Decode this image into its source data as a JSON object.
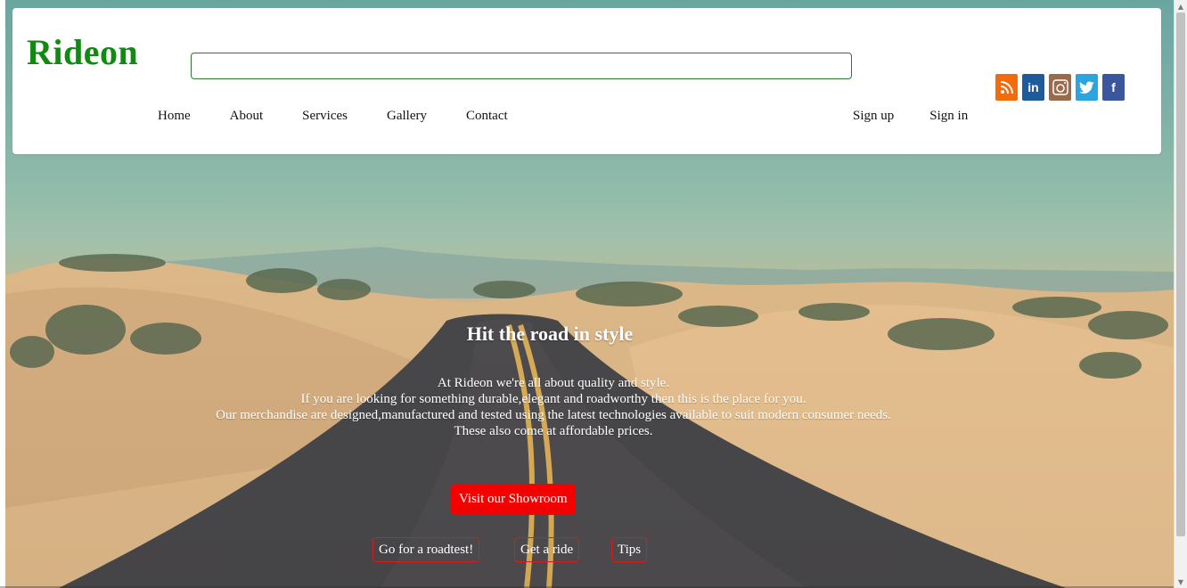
{
  "brand": {
    "name": "Rideon",
    "color": "#128a12"
  },
  "search": {
    "value": "",
    "placeholder": ""
  },
  "nav": {
    "items": [
      {
        "label": "Home"
      },
      {
        "label": "About"
      },
      {
        "label": "Services"
      },
      {
        "label": "Gallery"
      },
      {
        "label": "Contact"
      }
    ],
    "auth": [
      {
        "label": "Sign up"
      },
      {
        "label": "Sign in"
      }
    ]
  },
  "social": [
    {
      "name": "rss-icon",
      "glyph": "◗",
      "color": "#f26c0b"
    },
    {
      "name": "linkedin-icon",
      "glyph": "in",
      "color": "#1e5b98"
    },
    {
      "name": "instagram-icon",
      "glyph": "◉",
      "color": "#9a6a4c"
    },
    {
      "name": "twitter-icon",
      "glyph": "❀",
      "color": "#2aa5dd"
    },
    {
      "name": "facebook-icon",
      "glyph": "f",
      "color": "#3a569d"
    }
  ],
  "hero": {
    "title": "Hit the road in style",
    "lines": [
      "At Rideon we're all about quality and style.",
      "If you are looking for something durable,elegant and roadworthy then this is the place for you.",
      "Our merchandise are designed,manufactured and tested using the latest technologies available to suit modern consumer needs.",
      "These also come at affordable prices."
    ],
    "primary_button": "Visit our Showroom",
    "primary_color": "#f50000",
    "secondary_buttons": [
      {
        "label": "Go for a roadtest!"
      },
      {
        "label": "Get a ride"
      },
      {
        "label": "Tips"
      }
    ]
  }
}
